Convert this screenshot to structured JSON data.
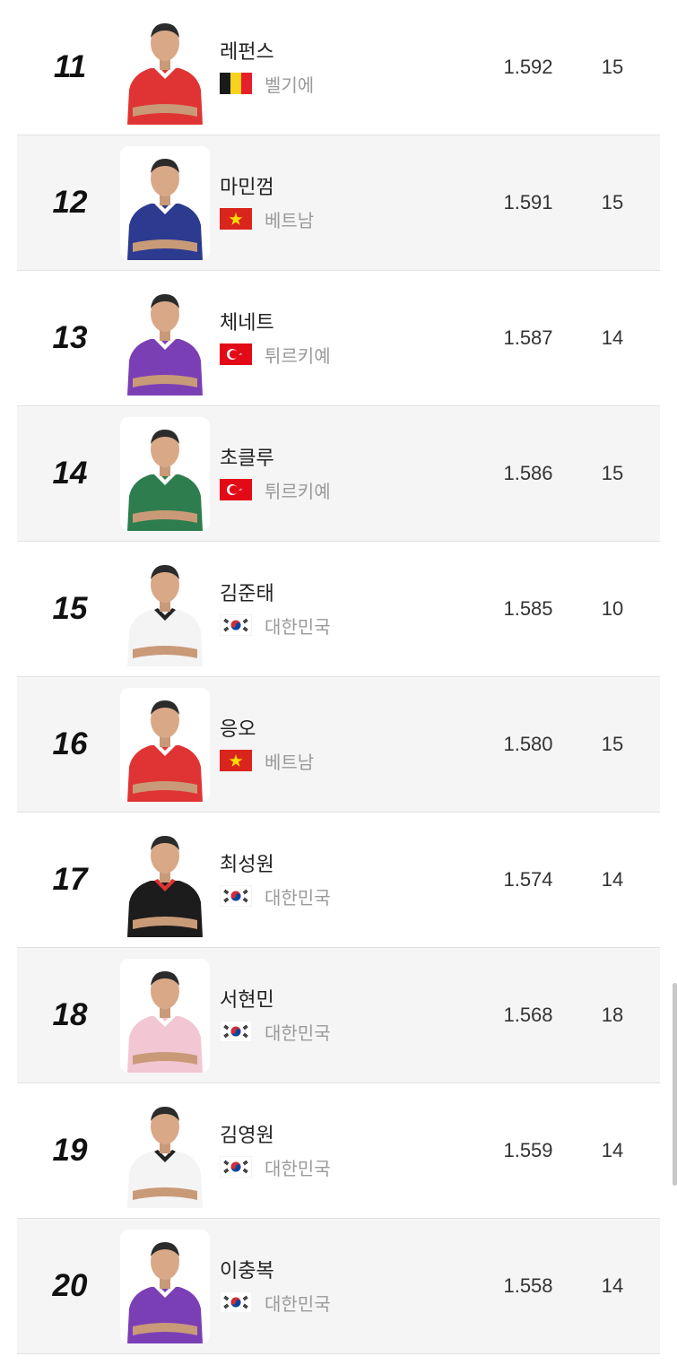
{
  "rows": [
    {
      "rank": "11",
      "name": "레펀스",
      "country": "벨기에",
      "flag": "belgium",
      "points": "1.592",
      "games": "15",
      "jersey": "#e03434",
      "collar": "#ffffff",
      "alt": false
    },
    {
      "rank": "12",
      "name": "마민껌",
      "country": "베트남",
      "flag": "vietnam",
      "points": "1.591",
      "games": "15",
      "jersey": "#2c3a8f",
      "collar": "#ffffff",
      "alt": true
    },
    {
      "rank": "13",
      "name": "체네트",
      "country": "튀르키예",
      "flag": "turkey",
      "points": "1.587",
      "games": "14",
      "jersey": "#7b3fb5",
      "collar": "#ffffff",
      "alt": false
    },
    {
      "rank": "14",
      "name": "초클루",
      "country": "튀르키예",
      "flag": "turkey",
      "points": "1.586",
      "games": "15",
      "jersey": "#2e7d4f",
      "collar": "#ffffff",
      "alt": true
    },
    {
      "rank": "15",
      "name": "김준태",
      "country": "대한민국",
      "flag": "korea",
      "points": "1.585",
      "games": "10",
      "jersey": "#f4f4f4",
      "collar": "#222222",
      "alt": false
    },
    {
      "rank": "16",
      "name": "응오",
      "country": "베트남",
      "flag": "vietnam",
      "points": "1.580",
      "games": "15",
      "jersey": "#e03434",
      "collar": "#ffffff",
      "alt": true
    },
    {
      "rank": "17",
      "name": "최성원",
      "country": "대한민국",
      "flag": "korea",
      "points": "1.574",
      "games": "14",
      "jersey": "#1c1c1c",
      "collar": "#d33",
      "alt": false
    },
    {
      "rank": "18",
      "name": "서현민",
      "country": "대한민국",
      "flag": "korea",
      "points": "1.568",
      "games": "18",
      "jersey": "#f3c6d4",
      "collar": "#ffffff",
      "alt": true
    },
    {
      "rank": "19",
      "name": "김영원",
      "country": "대한민국",
      "flag": "korea",
      "points": "1.559",
      "games": "14",
      "jersey": "#f4f4f4",
      "collar": "#222222",
      "alt": false
    },
    {
      "rank": "20",
      "name": "이충복",
      "country": "대한민국",
      "flag": "korea",
      "points": "1.558",
      "games": "14",
      "jersey": "#7b3fb5",
      "collar": "#ffffff",
      "alt": true
    }
  ]
}
